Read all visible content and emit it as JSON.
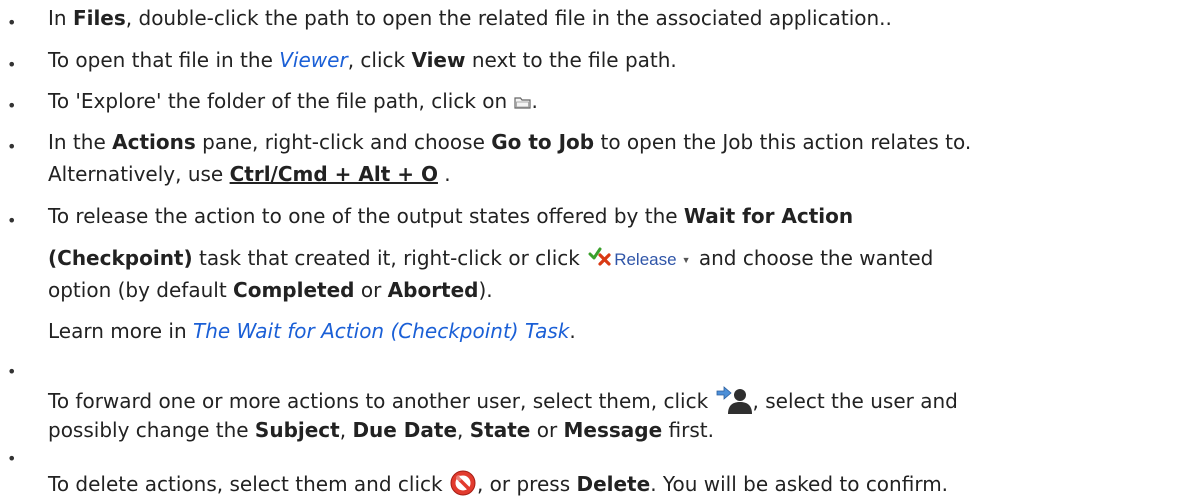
{
  "items": [
    {
      "lines": [
        [
          "In ",
          "Files",
          ", double-click the path to open the related file in the associated application.."
        ]
      ]
    },
    {
      "lines": [
        [
          "To open that file in the ",
          "Viewer",
          ", click ",
          "View",
          " next to the file path."
        ]
      ]
    },
    {
      "lines": [
        [
          "To 'Explore' the folder of the file path, click on ",
          "."
        ]
      ],
      "icon": "folder-icon"
    },
    {
      "lines": [
        [
          "In the ",
          "Actions",
          " pane, right-click and choose ",
          "Go to Job",
          " to open the Job this action relates to."
        ],
        [
          "Alternatively, use ",
          "Ctrl/Cmd + Alt + O",
          " ."
        ]
      ]
    },
    {
      "lines": [
        [
          "To release the action to one of the output states offered by the ",
          "Wait for Action"
        ],
        [
          "(Checkpoint)",
          " task that created it, right-click or click ",
          " and choose the wanted"
        ],
        [
          "option (by default ",
          "Completed",
          " or ",
          "Aborted",
          ")."
        ],
        [
          "Learn more in ",
          "The Wait for Action (Checkpoint) Task",
          "."
        ]
      ],
      "release_label": "Release",
      "icon": "checkmark-x-release-icon"
    },
    {
      "lines": [
        [
          "To forward one or more actions to another user, select them, click ",
          ", select the user and"
        ],
        [
          "possibly change the ",
          "Subject",
          ", ",
          "Due Date",
          ", ",
          "State",
          " or ",
          "Message",
          " first."
        ]
      ],
      "icon": "forward-user-icon"
    },
    {
      "lines": [
        [
          "To delete actions, select them and click ",
          ", or press ",
          "Delete",
          ". You will be asked to confirm."
        ]
      ],
      "icon": "delete-prohibited-icon"
    }
  ],
  "bullet_char": "•",
  "colors": {
    "text": "#222222",
    "link": "#1a5fd6",
    "release_text": "#2f55a8"
  }
}
